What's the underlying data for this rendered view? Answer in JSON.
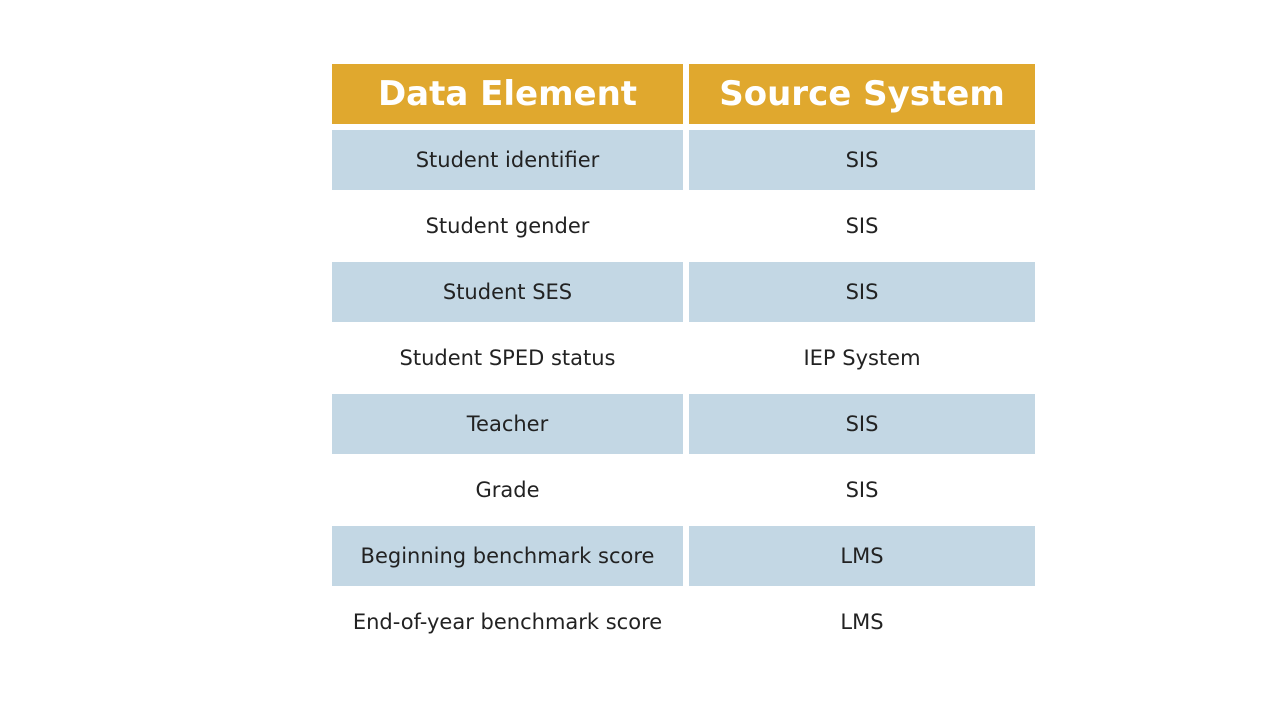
{
  "table": {
    "headers": [
      "Data Element",
      "Source System"
    ],
    "rows": [
      {
        "element": "Student identifier",
        "source": "SIS",
        "shaded": true
      },
      {
        "element": "Student gender",
        "source": "SIS",
        "shaded": false
      },
      {
        "element": "Student SES",
        "source": "SIS",
        "shaded": true
      },
      {
        "element": "Student SPED status",
        "source": "IEP System",
        "shaded": false
      },
      {
        "element": "Teacher",
        "source": "SIS",
        "shaded": true
      },
      {
        "element": "Grade",
        "source": "SIS",
        "shaded": false
      },
      {
        "element": "Beginning benchmark score",
        "source": "LMS",
        "shaded": true
      },
      {
        "element": "End-of-year benchmark score",
        "source": "LMS",
        "shaded": false
      }
    ]
  },
  "colors": {
    "header": "#e0a82e",
    "shaded_row": "#c3d7e4",
    "text": "#222222"
  }
}
